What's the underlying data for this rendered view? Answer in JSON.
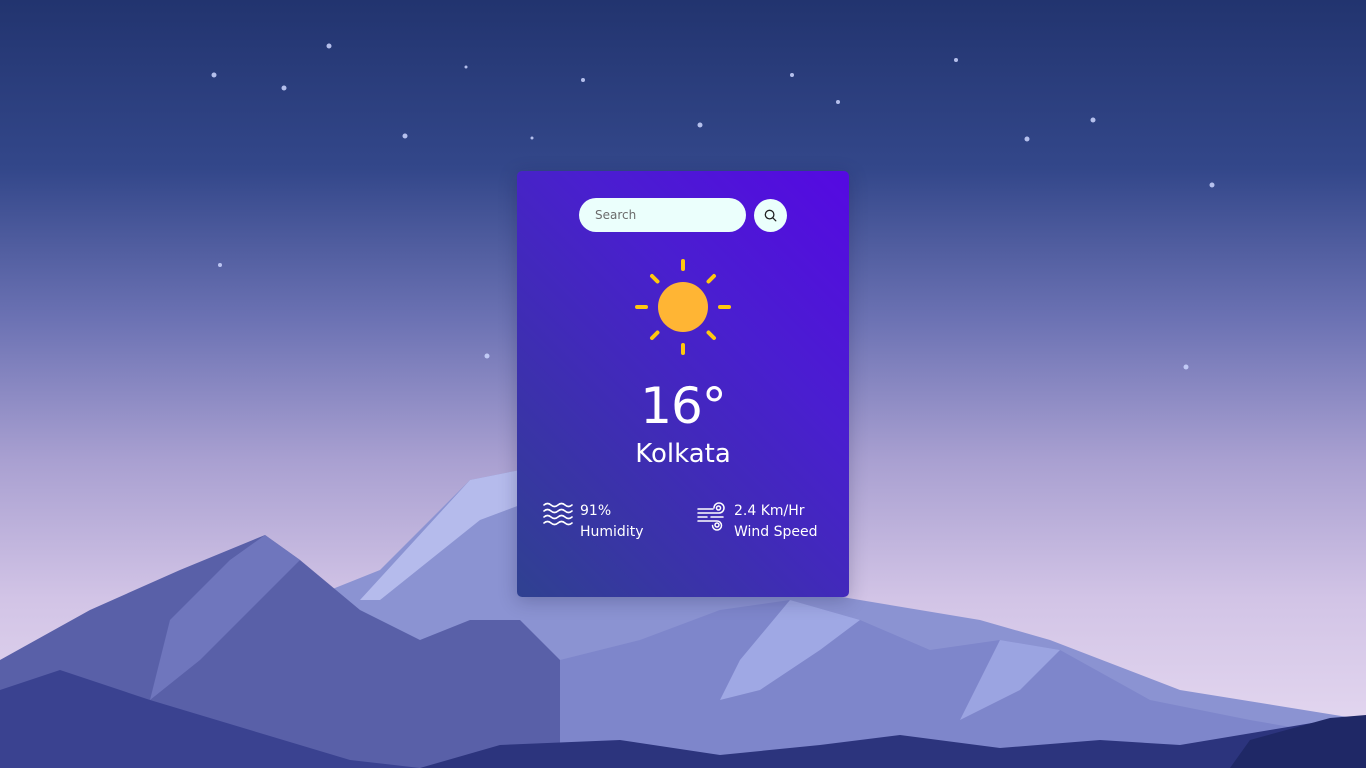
{
  "search": {
    "placeholder": "Search",
    "value": ""
  },
  "weather": {
    "icon": "sun-icon",
    "temperature": "16°",
    "city": "Kolkata"
  },
  "humidity": {
    "value": "91%",
    "label": "Humidity",
    "icon": "humidity-icon"
  },
  "wind": {
    "value": "2.4 Km/Hr",
    "label": "Wind Speed",
    "icon": "wind-icon"
  },
  "colors": {
    "card_top": "#5509e2",
    "card_bottom": "#2f4190",
    "input_bg": "#ebfffc",
    "sun": "#ffb534",
    "sun_rays": "#ffc80e"
  }
}
